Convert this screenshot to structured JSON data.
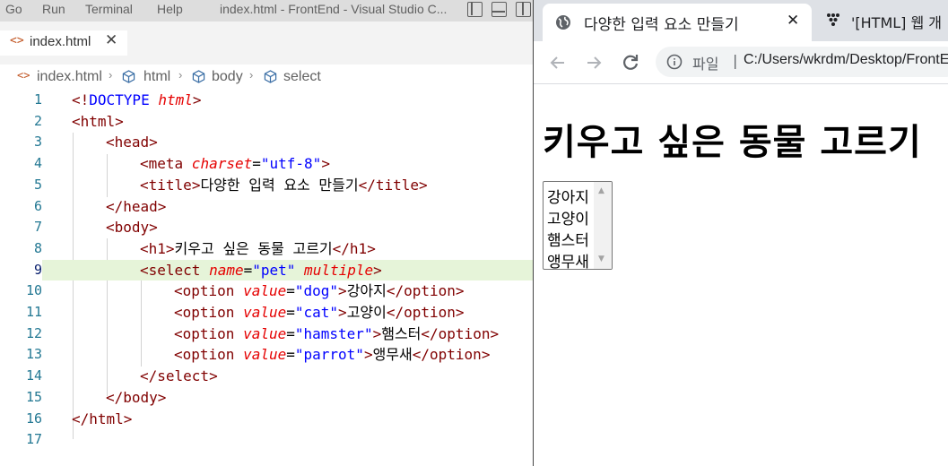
{
  "vscode": {
    "menu": [
      "Go",
      "Run",
      "Terminal",
      "Help"
    ],
    "window_title": "index.html - FrontEnd - Visual Studio C...",
    "tab": {
      "label": "index.html",
      "close": "✕",
      "file_icon": "<>"
    },
    "breadcrumb": [
      "index.html",
      "html",
      "body",
      "select"
    ],
    "line_numbers": [
      "1",
      "2",
      "3",
      "4",
      "5",
      "6",
      "7",
      "8",
      "9",
      "10",
      "11",
      "12",
      "13",
      "14",
      "15",
      "16",
      "17"
    ],
    "code": {
      "l1": {
        "p1": "<!",
        "k": "DOCTYPE",
        "a": " html",
        "p2": ">"
      },
      "l2": {
        "p1": "<",
        "t": "html",
        "p2": ">"
      },
      "l3": {
        "p1": "<",
        "t": "head",
        "p2": ">"
      },
      "l4": {
        "p1": "<",
        "t": "meta",
        "a": " charset",
        "eq": "=",
        "v": "\"utf-8\"",
        "p2": ">"
      },
      "l5": {
        "p1": "<",
        "t": "title",
        "p2": ">",
        "text": "다양한 입력 요소 만들기",
        "p3": "</",
        "t2": "title",
        "p4": ">"
      },
      "l6": {
        "p1": "</",
        "t": "head",
        "p2": ">"
      },
      "l7": {
        "p1": "<",
        "t": "body",
        "p2": ">"
      },
      "l8": {
        "p1": "<",
        "t": "h1",
        "p2": ">",
        "text": "키우고 싶은 동물 고르기",
        "p3": "</",
        "t2": "h1",
        "p4": ">"
      },
      "l9": {
        "p1": "<",
        "t": "select",
        "a": " name",
        "eq": "=",
        "v": "\"pet\"",
        "a2": " multiple",
        "p2": ">"
      },
      "l10": {
        "p1": "<",
        "t": "option",
        "a": " value",
        "eq": "=",
        "v": "\"dog\"",
        "p2": ">",
        "text": "강아지",
        "p3": "</",
        "t2": "option",
        "p4": ">"
      },
      "l11": {
        "p1": "<",
        "t": "option",
        "a": " value",
        "eq": "=",
        "v": "\"cat\"",
        "p2": ">",
        "text": "고양이",
        "p3": "</",
        "t2": "option",
        "p4": ">"
      },
      "l12": {
        "p1": "<",
        "t": "option",
        "a": " value",
        "eq": "=",
        "v": "\"hamster\"",
        "p2": ">",
        "text": "햄스터",
        "p3": "</",
        "t2": "option",
        "p4": ">"
      },
      "l13": {
        "p1": "<",
        "t": "option",
        "a": " value",
        "eq": "=",
        "v": "\"parrot\"",
        "p2": ">",
        "text": "앵무새",
        "p3": "</",
        "t2": "option",
        "p4": ">"
      },
      "l14": {
        "p1": "</",
        "t": "select",
        "p2": ">"
      },
      "l15": {
        "p1": "</",
        "t": "body",
        "p2": ">"
      },
      "l16": {
        "p1": "</",
        "t": "html",
        "p2": ">"
      }
    }
  },
  "browser": {
    "active_tab": {
      "title": "다양한 입력 요소 만들기",
      "close": "✕"
    },
    "second_tab": {
      "title": "'[HTML] 웹 개"
    },
    "omnibox": {
      "scheme": "파일",
      "divider": "|",
      "url": "C:/Users/wkrdm/Desktop/FrontEnd/index.html"
    },
    "page": {
      "h1": "키우고 싶은 동물 고르기",
      "options": [
        "강아지",
        "고양이",
        "햄스터",
        "앵무새"
      ]
    }
  },
  "colors": {
    "tag": "#800000",
    "attribute": "#e50000",
    "value": "#0000ff",
    "line_highlight": "#e6f4d9",
    "line_number": "#237893",
    "tab_strip": "#dee1e6"
  },
  "icons": [
    "file-html-icon",
    "cube-icon",
    "layout-sidebar-icon",
    "layout-panel-icon",
    "layout-split-icon",
    "globe-favicon-icon",
    "back-icon",
    "forward-icon",
    "reload-icon",
    "info-icon",
    "close-icon"
  ]
}
